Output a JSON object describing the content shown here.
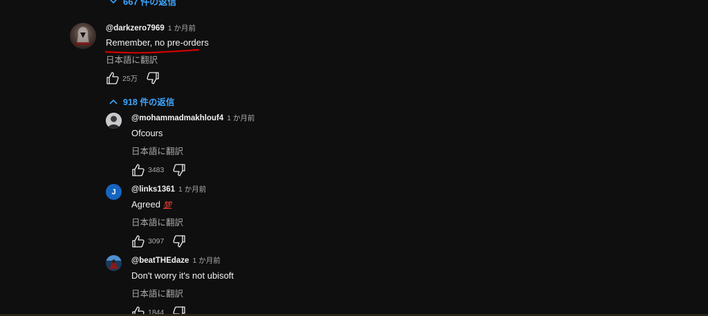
{
  "top_replies": {
    "label": "667 件の返信"
  },
  "main_comment": {
    "author": "@darkzero7969",
    "time": "1 か月前",
    "text": "Remember, no pre-orders",
    "translate": "日本語に翻訳",
    "likes": "25万"
  },
  "replies_toggle": {
    "label": "918 件の返信"
  },
  "replies": [
    {
      "author": "@mohammadmakhlouf4",
      "time": "1 か月前",
      "text": "Ofcours",
      "translate": "日本語に翻訳",
      "likes": "3483",
      "avatar_initial": ""
    },
    {
      "author": "@links1361",
      "time": "1 か月前",
      "text": "Agreed",
      "emoji": "💯",
      "translate": "日本語に翻訳",
      "likes": "3097",
      "avatar_initial": "J",
      "avatar_color": "#1565c0"
    },
    {
      "author": "@beatTHEdaze",
      "time": "1 か月前",
      "text": "Don't worry it's not ubisoft",
      "translate": "日本語に翻訳",
      "likes": "1844",
      "avatar_initial": ""
    }
  ],
  "colors": {
    "background": "#0f0f0f",
    "link": "#3ea6ff",
    "secondary_text": "#aaaaaa",
    "annotation_underline": "#d00000"
  },
  "icons": [
    "chevron-down-icon",
    "chevron-up-icon",
    "thumbs-up-icon",
    "thumbs-down-icon",
    "hundred-points-emoji"
  ]
}
